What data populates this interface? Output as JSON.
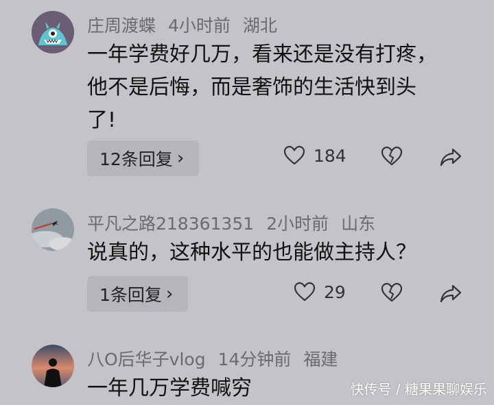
{
  "comments": [
    {
      "user": "庄周渡蝶",
      "time": "4小时前",
      "location": "湖北",
      "lines": [
        "一年学费好几万，看来还是没有打疼，",
        "他不是后悔，而是奢饰的生活快到头",
        "了!"
      ],
      "reply_label": "12条回复",
      "likes": "184",
      "avatar_icon": "monster-avatar"
    },
    {
      "user": "平凡之路218361351",
      "time": "2小时前",
      "location": "山东",
      "lines": [
        "说真的，这种水平的也能做主持人？"
      ],
      "reply_label": "1条回复",
      "likes": "29",
      "avatar_icon": "sky-airplane-avatar"
    },
    {
      "user": "八O后华子vlog",
      "time": "14分钟前",
      "location": "福建",
      "lines": [
        "一年几万学费喊穷"
      ],
      "avatar_icon": "silhouette-sunset-avatar"
    }
  ],
  "watermark": "快传号 / 糖果果聊娱乐",
  "colors": {
    "background": "#c4c3c8",
    "reply_bg": "#b6b5ba",
    "meta": "#6b6a6f"
  }
}
